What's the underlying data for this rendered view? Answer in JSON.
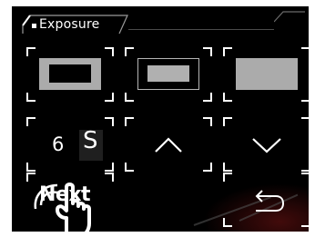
{
  "header": {
    "title": "Exposure"
  },
  "metering": [
    {
      "icon": "center-weighted-metering-icon"
    },
    {
      "icon": "spot-metering-icon"
    },
    {
      "icon": "average-metering-icon"
    }
  ],
  "exposure_value": {
    "number": "6",
    "unit": "S"
  },
  "controls": {
    "up_icon": "chevron-up-icon",
    "down_icon": "chevron-down-icon",
    "back_icon": "return-arrow-icon"
  },
  "next": {
    "label": "Next",
    "pointer_icon": "hand-pointer-icon"
  },
  "colors": {
    "background": "#000000",
    "accent": "#ffffff",
    "fill_gray": "#ababab",
    "glow": "#781414"
  }
}
